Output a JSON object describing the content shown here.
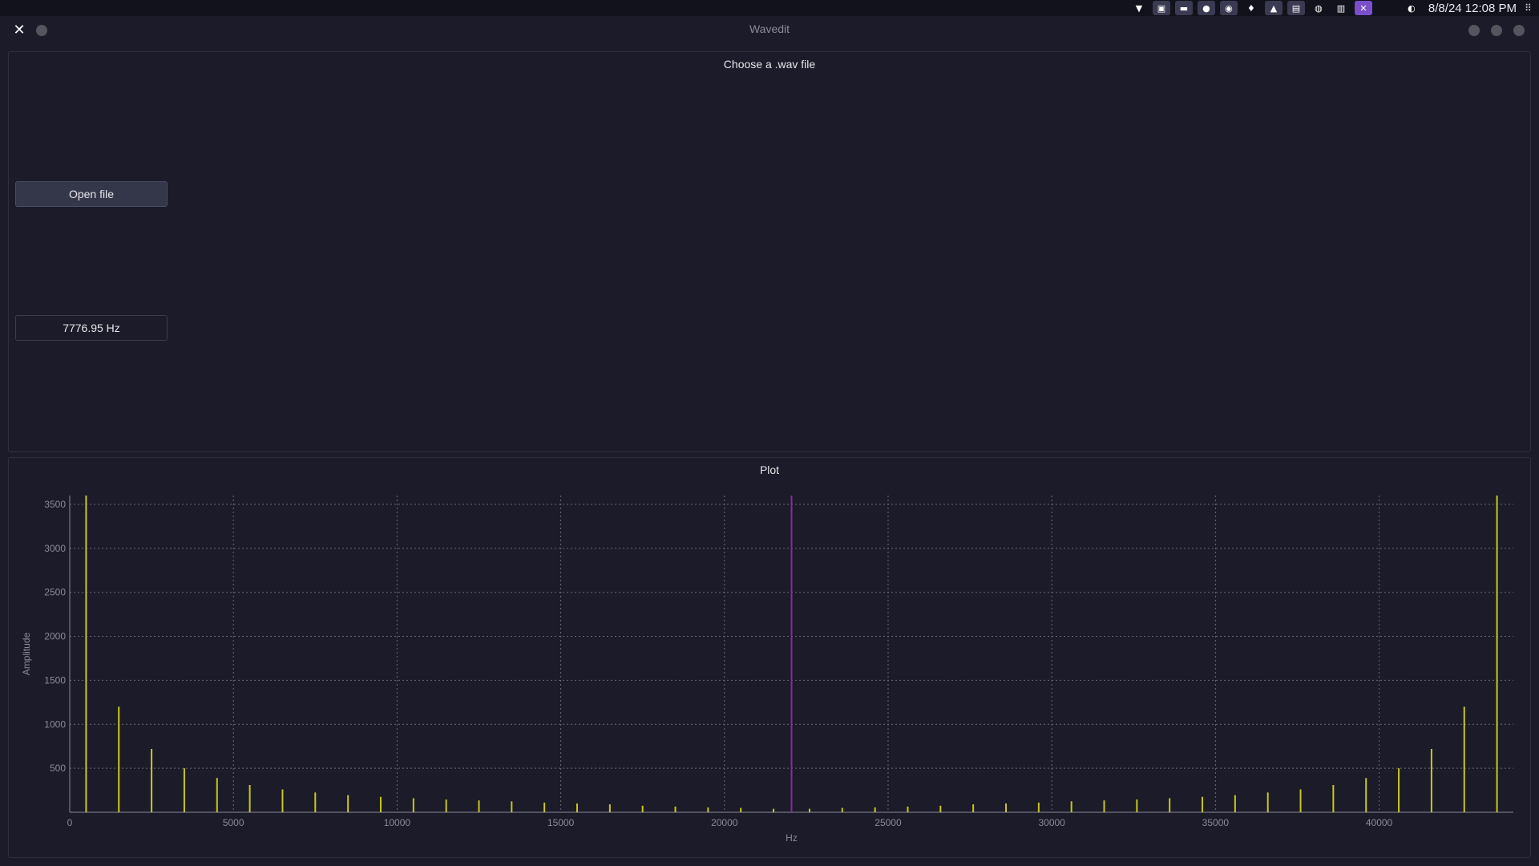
{
  "system_bar": {
    "clock": "8/8/24 12:08 PM",
    "tray_icons": [
      "download-icon",
      "app-icon",
      "window-icon",
      "ladybug-icon",
      "spotify-icon",
      "map-pin-icon",
      "app-icon",
      "document-icon",
      "globe-icon",
      "note-icon",
      "x-icon"
    ]
  },
  "window": {
    "title": "Wavedit"
  },
  "file_panel": {
    "title": "Choose a .wav file",
    "open_button_label": "Open file",
    "frequency_value": "7776.95 Hz"
  },
  "plot_panel": {
    "title": "Plot"
  },
  "colors": {
    "bars": "#c8c81e",
    "marker": "#8a2a9a",
    "grid": "#6a6a78",
    "axis": "#8a8a98"
  },
  "chart_data": {
    "type": "bar",
    "xlabel": "Hz",
    "ylabel": "Amplitude",
    "xlim": [
      0,
      44100
    ],
    "ylim": [
      0,
      3600
    ],
    "xticks": [
      0,
      5000,
      10000,
      15000,
      20000,
      25000,
      30000,
      35000,
      40000
    ],
    "yticks": [
      500,
      1000,
      1500,
      2000,
      2500,
      3000,
      3500
    ],
    "grid": true,
    "marker_x": 22050,
    "series": [
      {
        "x": [
          500,
          1500,
          2500,
          3500,
          4500,
          5500,
          6500,
          7500,
          8500,
          9500,
          10500,
          11500,
          12500,
          13500,
          14500,
          15500,
          16500,
          17500,
          18500,
          19500,
          20500,
          21500,
          22600,
          23600,
          24600,
          25600,
          26600,
          27600,
          28600,
          29600,
          30600,
          31600,
          32600,
          33600,
          34600,
          35600,
          36600,
          37600,
          38600,
          39600,
          40600,
          41600,
          42600,
          43600
        ],
        "values": [
          3600,
          1200,
          720,
          500,
          390,
          310,
          260,
          225,
          195,
          175,
          160,
          145,
          135,
          125,
          110,
          100,
          90,
          75,
          65,
          55,
          50,
          40,
          40,
          50,
          55,
          65,
          75,
          90,
          100,
          110,
          125,
          135,
          145,
          160,
          175,
          195,
          225,
          260,
          310,
          390,
          500,
          720,
          1200,
          3600
        ]
      }
    ]
  }
}
